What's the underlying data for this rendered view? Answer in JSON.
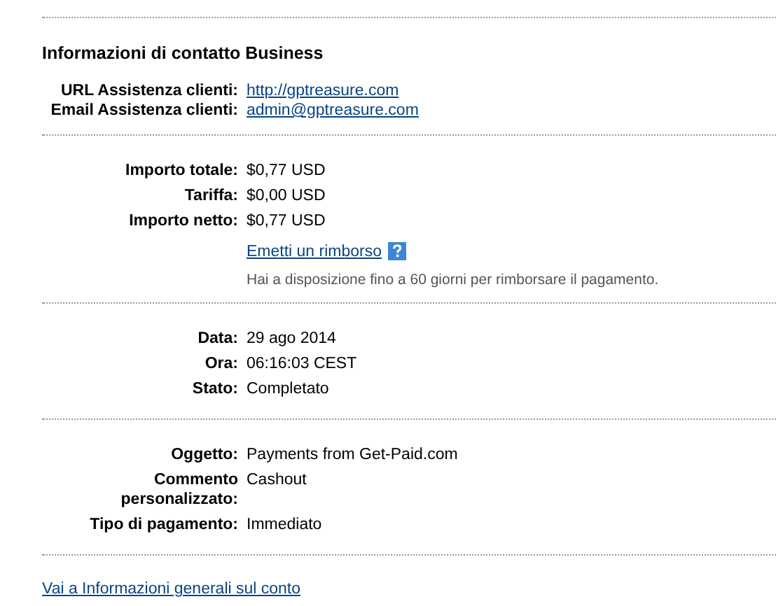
{
  "sections": [
    {
      "title": "Informazioni di contatto Business",
      "rows": [
        {
          "label": "URL Assistenza clienti:",
          "value": "http://gptreasure.com",
          "kind": "link"
        },
        {
          "label": "Email Assistenza clienti:",
          "value": "admin@gptreasure.com",
          "kind": "link"
        }
      ]
    },
    {
      "rows": [
        {
          "label": "Importo totale:",
          "value": "$0,77 USD",
          "kind": "text"
        },
        {
          "label": "Tariffa:",
          "value": "$0,00 USD",
          "kind": "text"
        },
        {
          "label": "Importo netto:",
          "value": "$0,77 USD",
          "kind": "text"
        }
      ],
      "refund_link": "Emetti un rimborso",
      "refund_note": "Hai a disposizione fino a 60 giorni per rimborsare il pagamento."
    },
    {
      "rows": [
        {
          "label": "Data:",
          "value": "29 ago 2014",
          "kind": "text"
        },
        {
          "label": "Ora:",
          "value": "06:16:03 CEST",
          "kind": "text"
        },
        {
          "label": "Stato:",
          "value": "Completato",
          "kind": "text"
        }
      ]
    },
    {
      "rows": [
        {
          "label": "Oggetto:",
          "value": "Payments from Get-Paid.com",
          "kind": "text"
        },
        {
          "label": "Commento personalizzato:",
          "value": "Cashout",
          "kind": "text"
        },
        {
          "label": "Tipo di pagamento:",
          "value": "Immediato",
          "kind": "text"
        }
      ]
    }
  ],
  "footer_link": "Vai a Informazioni generali sul conto"
}
